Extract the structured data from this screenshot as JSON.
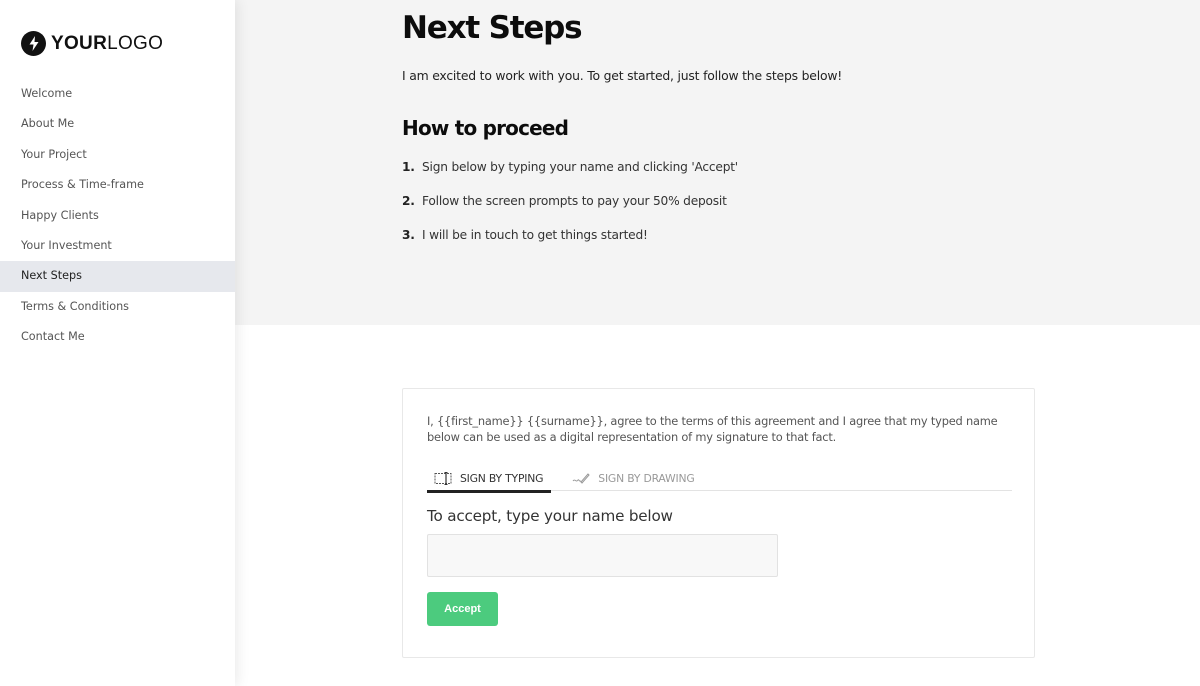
{
  "logo": {
    "bold": "YOUR",
    "light": "LOGO",
    "icon": "lightning-bolt-icon"
  },
  "sidebar": {
    "items": [
      {
        "label": "Welcome",
        "active": false
      },
      {
        "label": "About Me",
        "active": false
      },
      {
        "label": "Your Project",
        "active": false
      },
      {
        "label": "Process & Time-frame",
        "active": false
      },
      {
        "label": "Happy Clients",
        "active": false
      },
      {
        "label": "Your Investment",
        "active": false
      },
      {
        "label": "Next Steps",
        "active": true
      },
      {
        "label": "Terms & Conditions",
        "active": false
      },
      {
        "label": "Contact Me",
        "active": false
      }
    ]
  },
  "main": {
    "title": "Next Steps",
    "intro": "I am excited to work with you. To get started, just follow the steps below!",
    "section_title": "How to proceed",
    "steps": [
      {
        "num": "1.",
        "text": "Sign below by typing your name and clicking 'Accept'"
      },
      {
        "num": "2.",
        "text": "Follow the screen prompts to pay your 50% deposit"
      },
      {
        "num": "3.",
        "text": "I will be in touch to get things started!"
      }
    ]
  },
  "signature": {
    "agreement": "I, {{first_name}} {{surname}}, agree to the terms of this agreement and I agree that my typed name below can be used as a digital representation of my signature to that fact.",
    "tabs": [
      {
        "label": "SIGN BY TYPING",
        "icon": "text-cursor-icon",
        "active": true
      },
      {
        "label": "SIGN BY DRAWING",
        "icon": "pen-signature-icon",
        "active": false
      }
    ],
    "accept_label": "To accept, type your name below",
    "name_value": "",
    "name_placeholder": "",
    "accept_button": "Accept",
    "accent_color": "#4ccb7e"
  }
}
